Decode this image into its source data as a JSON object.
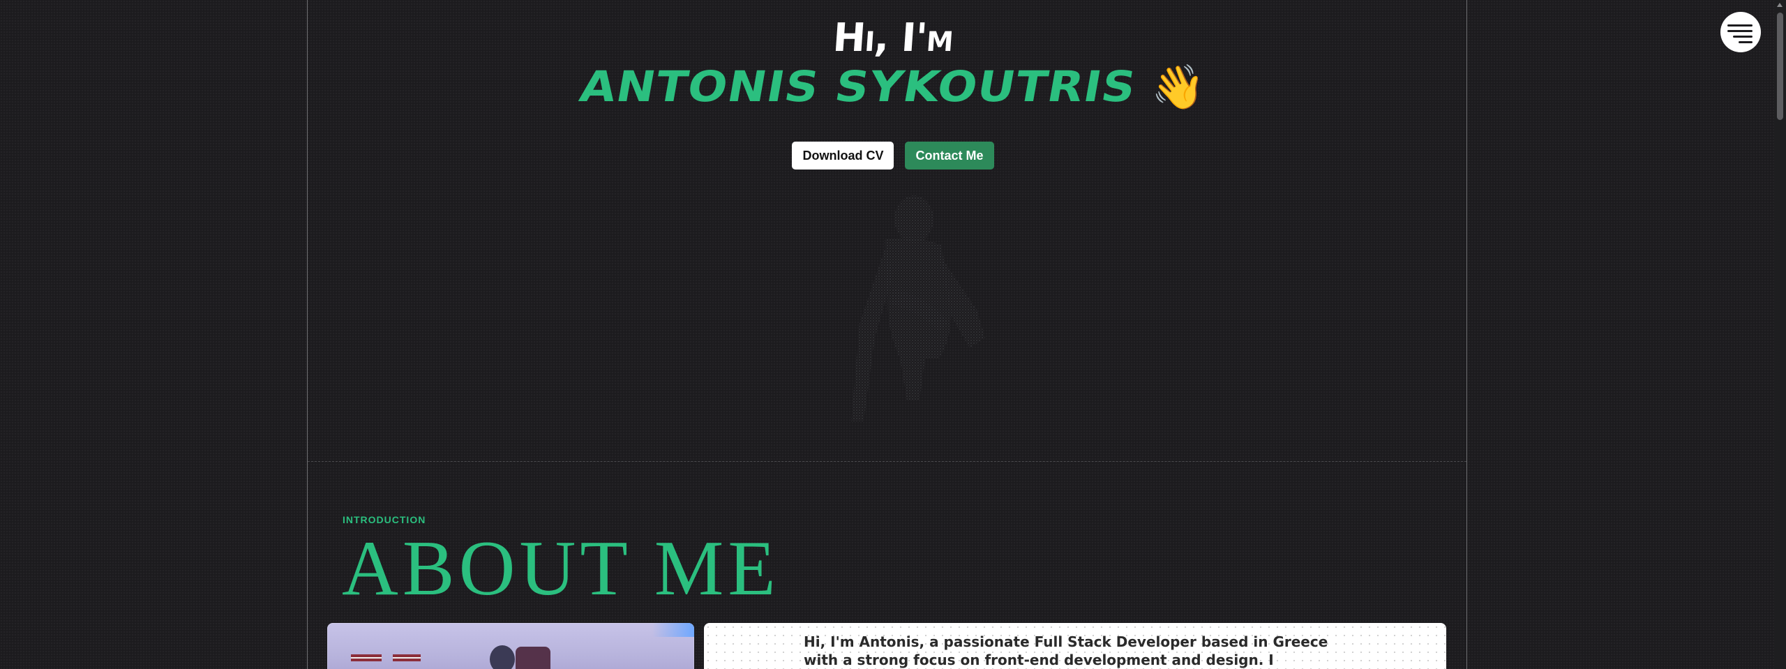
{
  "hero": {
    "greeting": "Hi, I'm",
    "name": "Antonis Sykoutris",
    "wave_emoji": "👋",
    "buttons": {
      "download_cv": "Download CV",
      "contact_me": "Contact Me"
    }
  },
  "about": {
    "kicker": "INTRODUCTION",
    "title": "ABOUT ME",
    "intro_text": "Hi, I'm Antonis, a passionate Full Stack Developer based in Greece with a strong focus on front-end development and design. I specialize in"
  },
  "nav": {
    "menu_icon": "hamburger-menu-icon"
  },
  "theme": {
    "background": "#1c1b1e",
    "accent": "#2bbf7f",
    "button_green": "#2d8a5a",
    "text_light": "#ffffff"
  }
}
